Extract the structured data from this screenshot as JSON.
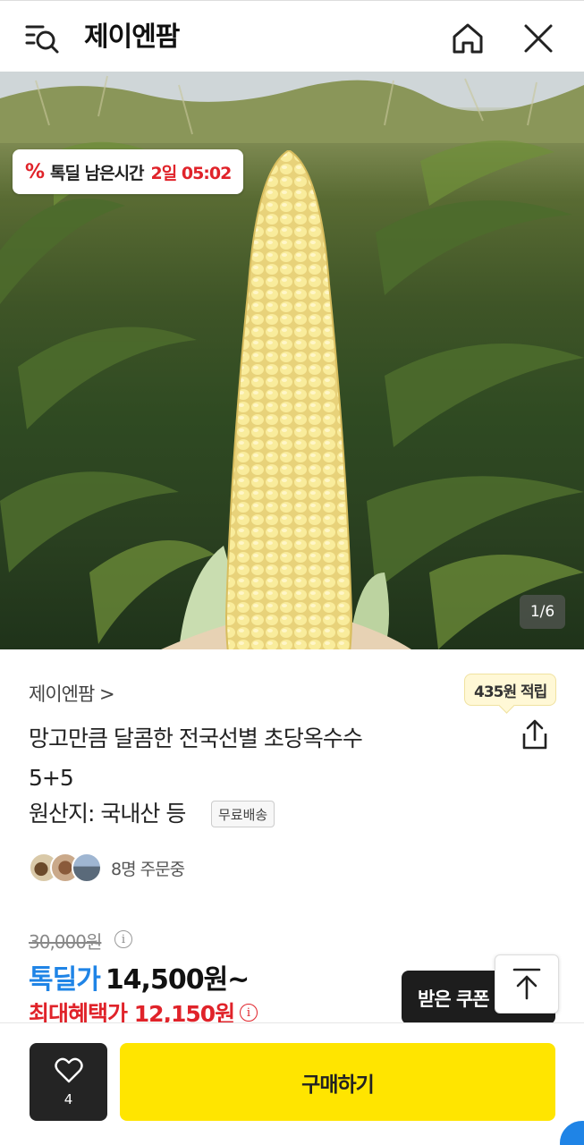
{
  "header": {
    "store_name": "제이엔팜",
    "icons": [
      "menu-search-icon",
      "home-icon",
      "close-icon"
    ]
  },
  "hero": {
    "deal_badge": {
      "percent_symbol": "%",
      "label": "톡딜 남은시간",
      "remaining": "2일 05:02"
    },
    "image_counter": "1/6"
  },
  "product": {
    "seller": "제이엔팜 >",
    "points_badge": "435원 적립",
    "title_line1": "망고만큼 달콤한 전국선별 초당옥수수",
    "title_line2": "5+5",
    "origin": "원산지: 국내산 등",
    "free_shipping": "무료배송",
    "orders": "8명 주문중"
  },
  "price": {
    "original": "30,000원",
    "deal_label": "톡딜가",
    "deal_price": "14,500원~",
    "max_benefit": "최대혜택가 12,150원"
  },
  "buttons": {
    "coupon": "받은 쿠폰",
    "like_count": "4",
    "buy": "구매하기"
  },
  "colors": {
    "deal_red": "#e0232a",
    "deal_blue": "#1f84e6",
    "buy_yellow": "#ffe500",
    "dark": "#242424"
  }
}
